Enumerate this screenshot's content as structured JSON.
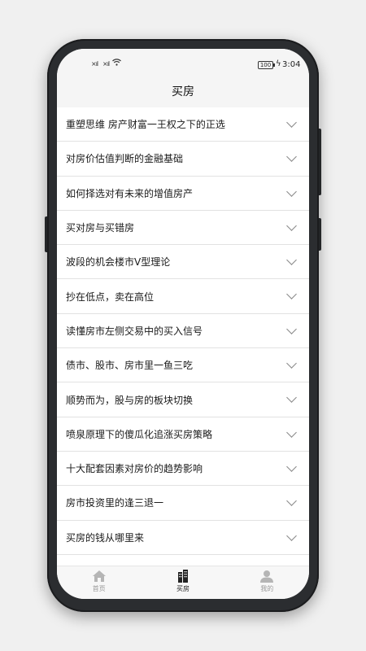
{
  "status_bar": {
    "signal": "…",
    "battery": "100",
    "time": "3:04"
  },
  "header": {
    "title": "买房"
  },
  "list": {
    "items": [
      {
        "label": "重塑思维 房产财富一王权之下的正选"
      },
      {
        "label": "对房价估值判断的金融基础"
      },
      {
        "label": "如何择选对有未来的增值房产"
      },
      {
        "label": "买对房与买错房"
      },
      {
        "label": "波段的机会楼市V型理论"
      },
      {
        "label": "抄在低点，卖在高位"
      },
      {
        "label": "读懂房市左侧交易中的买入信号"
      },
      {
        "label": "债市、股市、房市里一鱼三吃"
      },
      {
        "label": "顺势而为，股与房的板块切换"
      },
      {
        "label": "喷泉原理下的傻瓜化追涨买房策略"
      },
      {
        "label": "十大配套因素对房价的趋势影响"
      },
      {
        "label": "房市投资里的逢三退一"
      },
      {
        "label": "买房的钱从哪里来"
      },
      {
        "label": ""
      }
    ]
  },
  "tabbar": {
    "tabs": [
      {
        "label": "首页",
        "icon": "home-icon"
      },
      {
        "label": "买房",
        "icon": "building-icon"
      },
      {
        "label": "我的",
        "icon": "user-icon"
      }
    ]
  }
}
